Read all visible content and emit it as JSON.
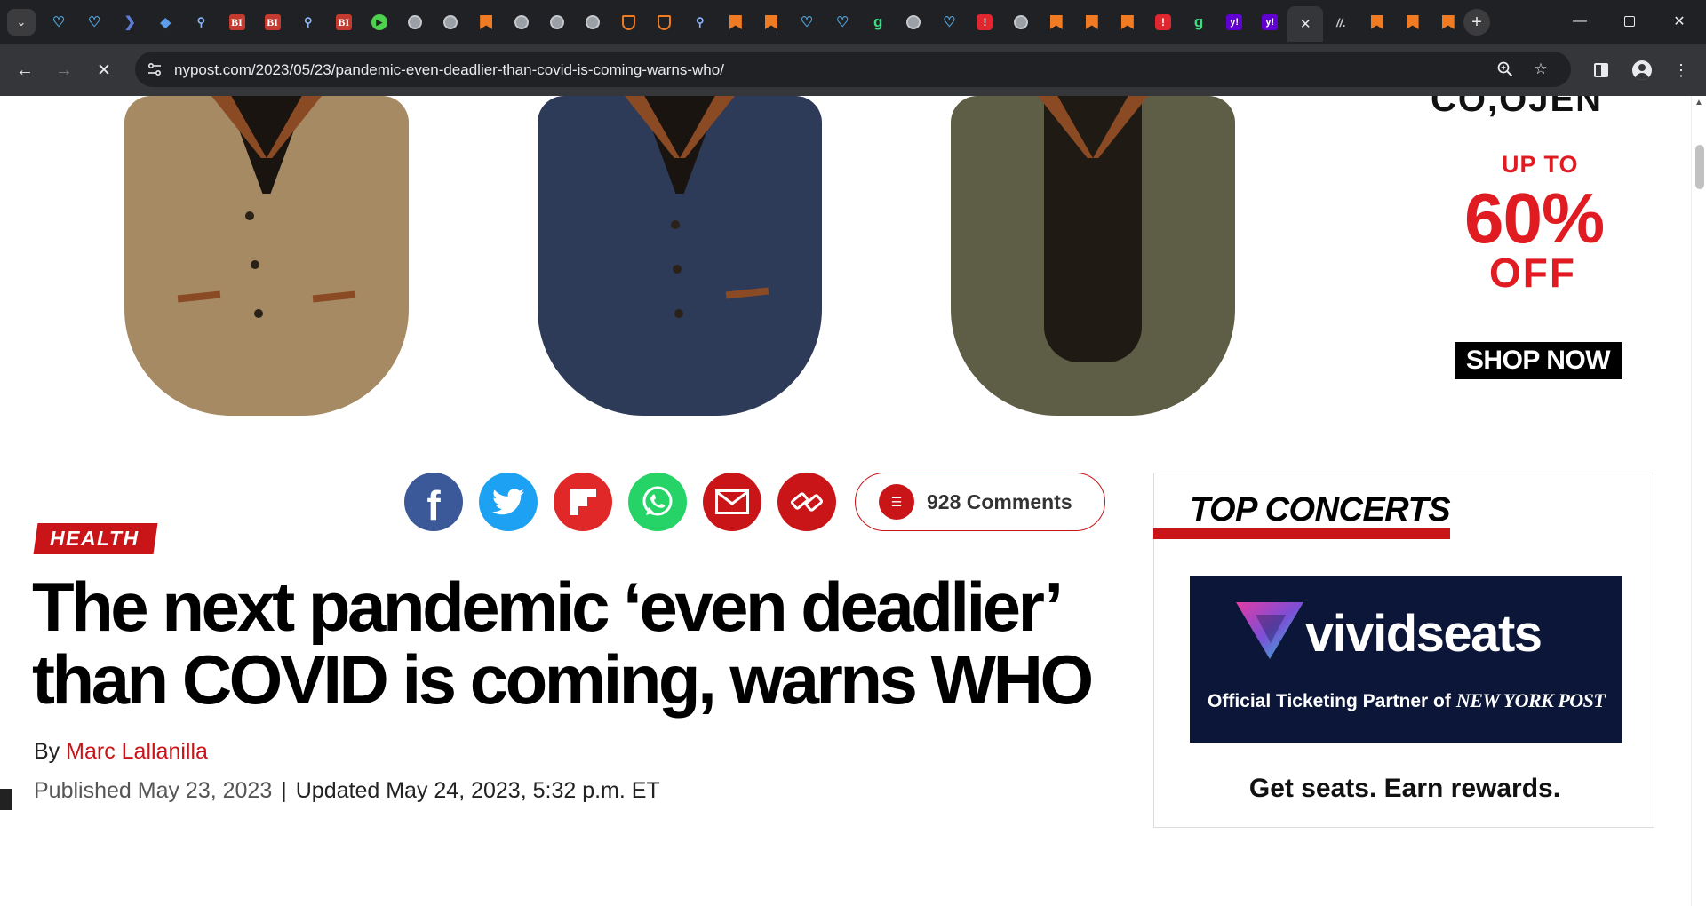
{
  "browser": {
    "url": "nypost.com/2023/05/23/pandemic-even-deadlier-than-covid-is-coming-warns-who/",
    "tabs": [
      {
        "icon": "heart-monitor-icon"
      },
      {
        "icon": "heart-monitor-icon"
      },
      {
        "icon": "chevron-logo-icon"
      },
      {
        "icon": "diamond-icon"
      },
      {
        "icon": "search-icon"
      },
      {
        "icon": "bi-icon",
        "text": "BI"
      },
      {
        "icon": "bi-icon",
        "text": "BI"
      },
      {
        "icon": "search-icon"
      },
      {
        "icon": "bi-icon",
        "text": "BI"
      },
      {
        "icon": "play-icon"
      },
      {
        "icon": "globe-icon"
      },
      {
        "icon": "globe-icon"
      },
      {
        "icon": "bookmark-icon"
      },
      {
        "icon": "globe-icon"
      },
      {
        "icon": "globe-icon"
      },
      {
        "icon": "globe-icon"
      },
      {
        "icon": "shield-icon"
      },
      {
        "icon": "shield-icon"
      },
      {
        "icon": "search-icon"
      },
      {
        "icon": "bookmark-icon"
      },
      {
        "icon": "bookmark-icon"
      },
      {
        "icon": "heart-monitor-icon"
      },
      {
        "icon": "heart-monitor-icon"
      },
      {
        "icon": "g-icon",
        "text": "g"
      },
      {
        "icon": "globe-icon"
      },
      {
        "icon": "heart-monitor-icon"
      },
      {
        "icon": "red-app-icon"
      },
      {
        "icon": "globe-icon"
      },
      {
        "icon": "bookmark-icon"
      },
      {
        "icon": "bookmark-icon"
      },
      {
        "icon": "bookmark-icon"
      },
      {
        "icon": "red-app-icon"
      },
      {
        "icon": "g-icon",
        "text": "g"
      },
      {
        "icon": "yahoo-icon",
        "text": "y!"
      },
      {
        "icon": "yahoo-icon",
        "text": "y!"
      },
      {
        "icon": "close-icon",
        "active": true
      },
      {
        "icon": "slash-icon",
        "text": "//."
      },
      {
        "icon": "bookmark-icon"
      },
      {
        "icon": "bookmark-icon"
      },
      {
        "icon": "bookmark-icon"
      }
    ]
  },
  "ad": {
    "headline_cut": "CO,OJEN",
    "up_to": "UP TO",
    "percent": "60%",
    "off": "OFF",
    "cta": "SHOP NOW"
  },
  "article": {
    "comments": "928 Comments",
    "section": "HEALTH",
    "headline": "The next pandemic ‘even deadlier’ than COVID is coming, warns WHO",
    "by_prefix": "By",
    "author": "Marc Lallanilla",
    "published": "Published May 23, 2023",
    "separator": "|",
    "updated": "Updated May 24, 2023, 5:32 p.m. ET"
  },
  "sidebar": {
    "title": "TOP CONCERTS",
    "vivid_name": "vividseats",
    "vivid_tagline": "Official Ticketing Partner of",
    "vivid_partner": "NEW YORK POST",
    "cta": "Get seats. Earn rewards."
  },
  "colors": {
    "nypost_red": "#c91418",
    "ad_red": "#e01b22",
    "facebook": "#3b5998",
    "twitter": "#1da1f2",
    "flipboard": "#e12828",
    "whatsapp": "#25d366",
    "email": "#c91418",
    "link": "#c91418"
  }
}
